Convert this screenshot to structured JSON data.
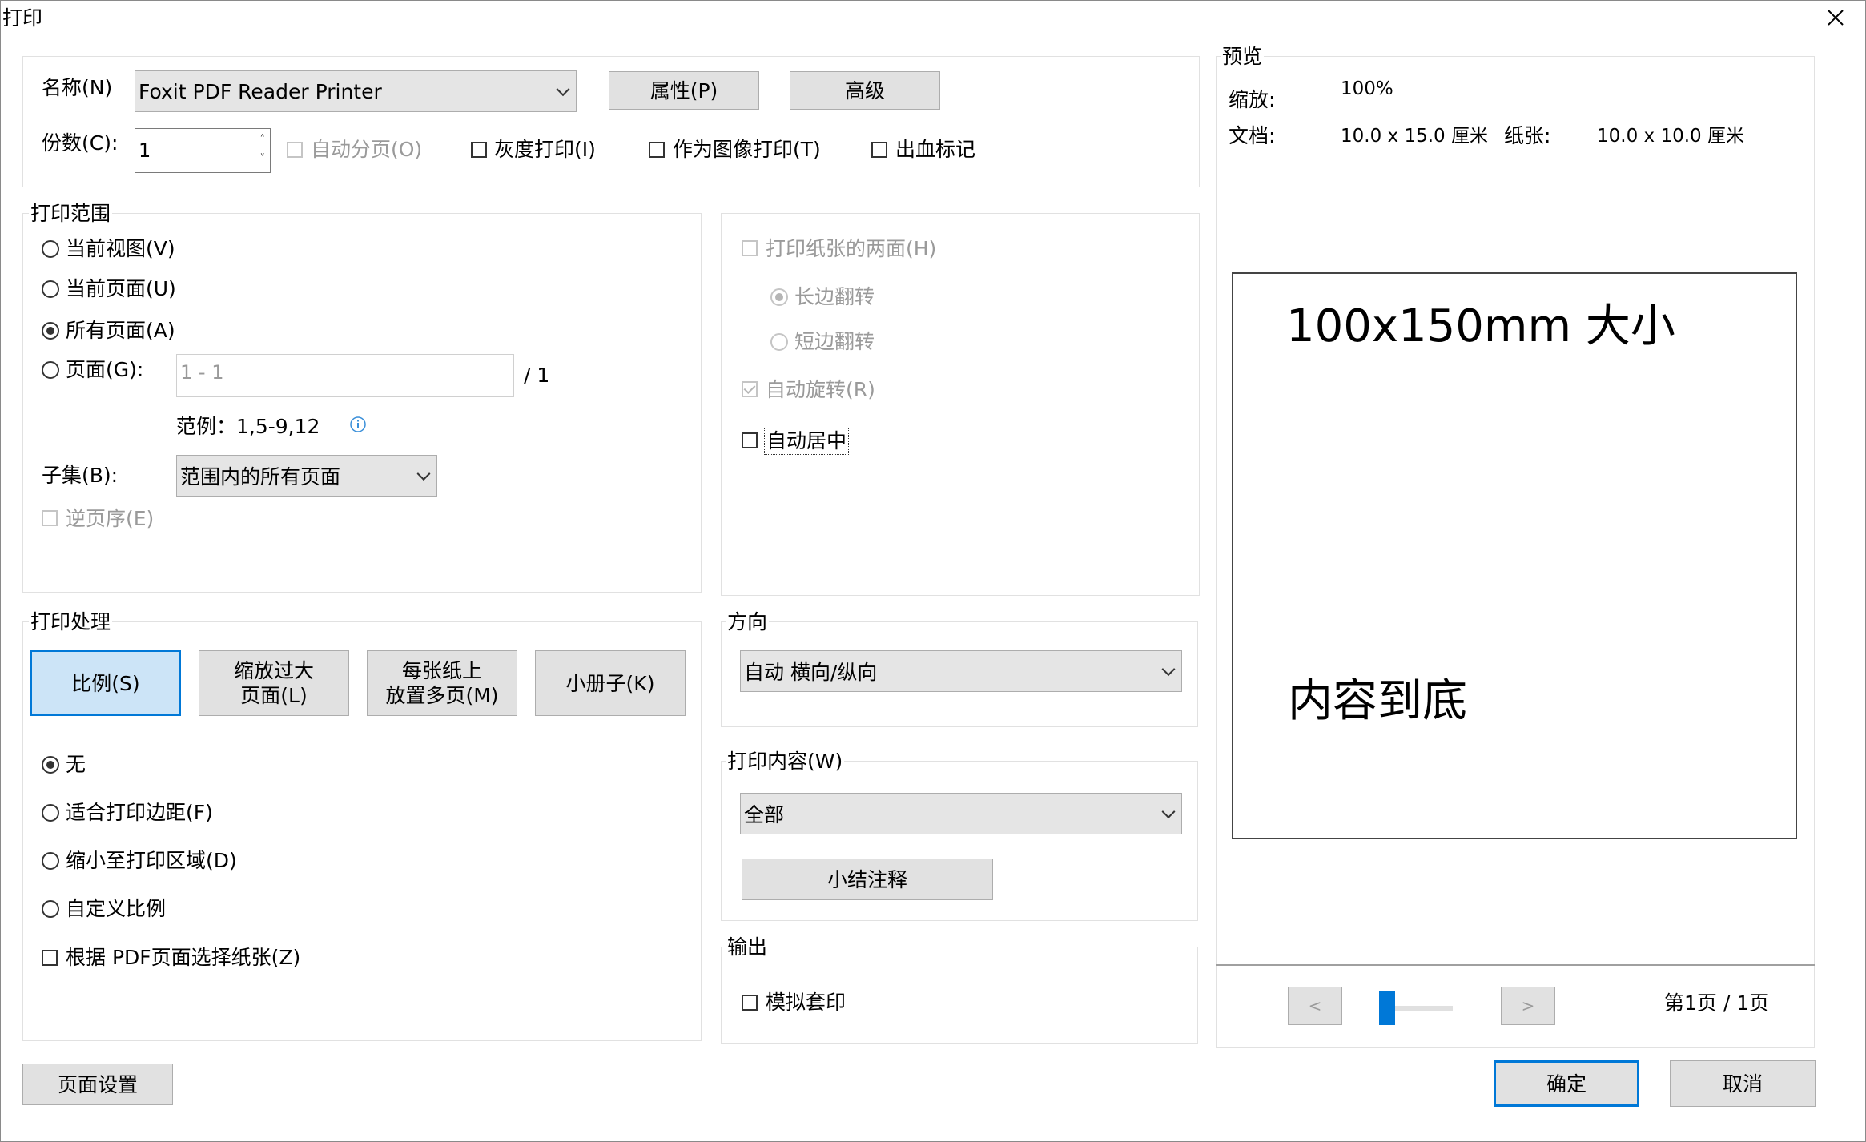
{
  "window": {
    "title": "打印",
    "close_icon": "close-icon"
  },
  "printer": {
    "name_label": "名称(N)",
    "name_value": "Foxit PDF Reader Printer",
    "properties_button": "属性(P)",
    "advanced_button": "高级",
    "copies_label": "份数(C):",
    "copies_value": "1",
    "collate_label": "自动分页(O)",
    "grayscale_label": "灰度打印(I)",
    "as_image_label": "作为图像打印(T)",
    "bleed_label": "出血标记"
  },
  "range": {
    "title": "打印范围",
    "current_view": "当前视图(V)",
    "current_page": "当前页面(U)",
    "all_pages": "所有页面(A)",
    "pages": "页面(G):",
    "pages_placeholder": "1 - 1",
    "pages_total": "/ 1",
    "example": "范例：1,5-9,12",
    "subset_label": "子集(B):",
    "subset_value": "范围内的所有页面",
    "reverse": "逆页序(E)"
  },
  "duplex": {
    "both_sides": "打印纸张的两面(H)",
    "long_edge": "长边翻转",
    "short_edge": "短边翻转",
    "auto_rotate": "自动旋转(R)",
    "auto_center": "自动居中"
  },
  "handling": {
    "title": "打印处理",
    "scale_button": "比例(S)",
    "fit_line1": "缩放过大",
    "fit_line2": "页面(L)",
    "multi_line1": "每张纸上",
    "multi_line2": "放置多页(M)",
    "booklet_button": "小册子(K)",
    "none": "无",
    "fit_margins": "适合打印边距(F)",
    "shrink": "缩小至打印区域(D)",
    "custom": "自定义比例",
    "choose_paper": "根据 PDF页面选择纸张(Z)"
  },
  "orientation": {
    "title": "方向",
    "value": "自动 横向/纵向"
  },
  "content": {
    "title": "打印内容(W)",
    "value": "全部",
    "summarize_button": "小结注释"
  },
  "output": {
    "title": "输出",
    "simulate": "模拟套印"
  },
  "preview": {
    "title": "预览",
    "zoom_label": "缩放:",
    "zoom_value": "100%",
    "doc_label": "文档:",
    "doc_value": "10.0 x 15.0 厘米",
    "paper_label": "纸张:",
    "paper_value": "10.0 x 10.0 厘米",
    "page_text_top": "100x150mm 大小",
    "page_text_bottom": "内容到底",
    "prev_button": "<",
    "next_button": ">",
    "page_indicator": "第1页 / 1页"
  },
  "footer": {
    "page_setup": "页面设置",
    "ok": "确定",
    "cancel": "取消"
  }
}
